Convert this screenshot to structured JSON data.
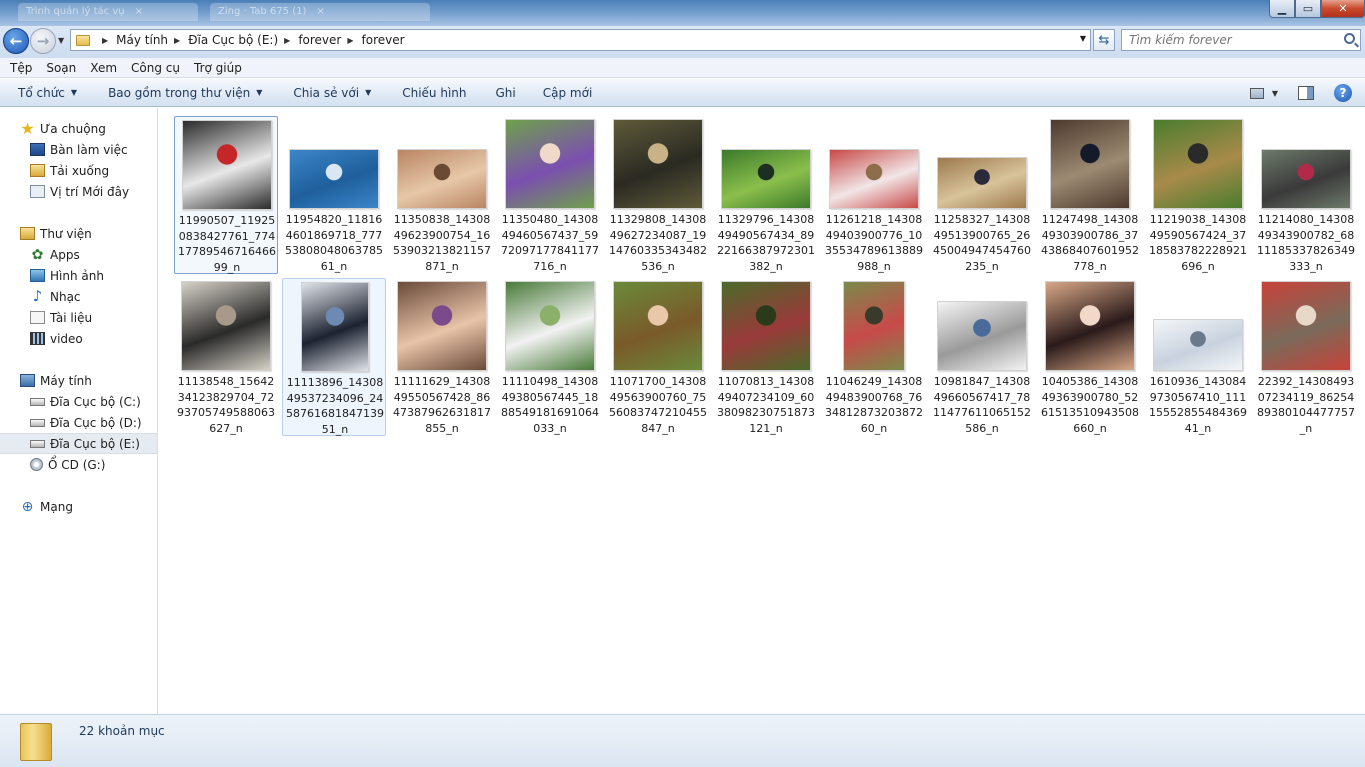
{
  "window": {
    "background_tabs": [
      "Trình quản lý tác vụ",
      "Zing · Tab 675 (1)"
    ]
  },
  "address": {
    "breadcrumbs": [
      "Máy tính",
      "Đĩa Cục bộ (E:)",
      "forever",
      "forever"
    ]
  },
  "search": {
    "placeholder": "Tìm kiếm forever"
  },
  "menu": [
    "Tệp",
    "Soạn",
    "Xem",
    "Công cụ",
    "Trợ giúp"
  ],
  "commands": [
    {
      "label": "Tổ chức",
      "dropdown": true
    },
    {
      "label": "Bao gồm trong thư viện",
      "dropdown": true
    },
    {
      "label": "Chia sẻ với",
      "dropdown": true
    },
    {
      "label": "Chiếu hình",
      "dropdown": false
    },
    {
      "label": "Ghi",
      "dropdown": false
    },
    {
      "label": "Cập mới",
      "dropdown": false
    }
  ],
  "nav": [
    {
      "label": "Ưa chuộng",
      "icon": "star-icon",
      "level": 0
    },
    {
      "label": "Bàn làm việc",
      "icon": "desktop-icon",
      "level": 1
    },
    {
      "label": "Tải xuống",
      "icon": "downloads-icon",
      "level": 1
    },
    {
      "label": "Vị trí Mới đây",
      "icon": "recent-places-icon",
      "level": 1
    },
    {
      "label": "Thư viện",
      "icon": "libraries-icon",
      "level": 0
    },
    {
      "label": "Apps",
      "icon": "apps-icon",
      "level": 1
    },
    {
      "label": "Hình ảnh",
      "icon": "pictures-icon",
      "level": 1
    },
    {
      "label": "Nhạc",
      "icon": "music-icon",
      "level": 1
    },
    {
      "label": "Tài liệu",
      "icon": "documents-icon",
      "level": 1
    },
    {
      "label": "video",
      "icon": "videos-icon",
      "level": 1
    },
    {
      "label": "Máy tính",
      "icon": "computer-icon",
      "level": 0
    },
    {
      "label": "Đĩa Cục bộ (C:)",
      "icon": "drive-icon",
      "level": 1
    },
    {
      "label": "Đĩa Cục bộ (D:)",
      "icon": "drive-icon",
      "level": 1
    },
    {
      "label": "Đĩa Cục bộ (E:)",
      "icon": "drive-icon",
      "level": 1,
      "selected": true
    },
    {
      "label": "Ổ CD (G:)",
      "icon": "cd-drive-icon",
      "level": 1
    },
    {
      "label": "Mạng",
      "icon": "network-icon",
      "level": 0
    }
  ],
  "files": [
    {
      "name": "11990507_119250838427761_7741778954671646699_n",
      "colors": [
        "#2b2b2b",
        "#e8e8e8",
        "#c4262a"
      ]
    },
    {
      "name": "11954820_118164601869718_7775380804806378561_n",
      "colors": [
        "#3b86c9",
        "#1f5f9c",
        "#d9e7f3"
      ]
    },
    {
      "name": "11350838_1430849623900754_1653903213821157871_n",
      "colors": [
        "#b98563",
        "#e6c7a8",
        "#6b4a33"
      ]
    },
    {
      "name": "11350480_1430849460567437_5972097177841177716_n",
      "colors": [
        "#6fa04b",
        "#7b4fb0",
        "#f0d9c8"
      ]
    },
    {
      "name": "11329808_1430849627234087_1914760335343482536_n",
      "colors": [
        "#5f5a3a",
        "#2a2a22",
        "#c9b287"
      ]
    },
    {
      "name": "11329796_1430849490567434_8922166387972301382_n",
      "colors": [
        "#3c7a2b",
        "#8bbf4c",
        "#1d2e22"
      ]
    },
    {
      "name": "11261218_1430849403900776_1035534789613889988_n",
      "colors": [
        "#c84848",
        "#f2e6e6",
        "#8e6e4a"
      ]
    },
    {
      "name": "11258327_1430849513900765_2645004947454760235_n",
      "colors": [
        "#9d7a4d",
        "#d8c39a",
        "#2a2a3a"
      ]
    },
    {
      "name": "11247498_1430849303900786_3743868407601952778_n",
      "colors": [
        "#4d3a2e",
        "#9c8a72",
        "#151a2a"
      ]
    },
    {
      "name": "11219038_1430849590567424_3718583782228921696_n",
      "colors": [
        "#4a7d2e",
        "#a88a4a",
        "#2a2a2a"
      ]
    },
    {
      "name": "11214080_1430849343900782_6811185337826349333_n",
      "colors": [
        "#6d7a6a",
        "#3a3a3a",
        "#b22a4a"
      ]
    },
    {
      "name": "11138548_1564234123829704_7293705749588063627_n",
      "colors": [
        "#d6d2c8",
        "#2a2a2a",
        "#a79a8a"
      ]
    },
    {
      "name": "11113896_1430849537234096_245876168184713951_n",
      "colors": [
        "#e0e4ea",
        "#1c2230",
        "#6d8ab3"
      ]
    },
    {
      "name": "11111629_1430849550567428_8647387962631817855_n",
      "colors": [
        "#6a4a3a",
        "#e8c4a8",
        "#7a4a8a"
      ]
    },
    {
      "name": "11110498_1430849380567445_1888549181691064033_n",
      "colors": [
        "#4a7a3a",
        "#f2f2f2",
        "#8ab06a"
      ]
    },
    {
      "name": "11071700_1430849563900760_7556083747210455847_n",
      "colors": [
        "#6a8a3a",
        "#7a5a2a",
        "#e8c8a8"
      ]
    },
    {
      "name": "11070813_1430849407234109_6038098230751873121_n",
      "colors": [
        "#4a6a2a",
        "#9a3a3a",
        "#2a3a1a"
      ]
    },
    {
      "name": "11046249_1430849483900768_763481287320387260_n",
      "colors": [
        "#7a8a4a",
        "#c84a4a",
        "#3a3a2a"
      ]
    },
    {
      "name": "10981847_1430849660567417_7811477611065152586_n",
      "colors": [
        "#f4f4f4",
        "#9a9a9a",
        "#4a6a9a"
      ]
    },
    {
      "name": "10405386_1430849363900780_5261513510943508660_n",
      "colors": [
        "#d8a888",
        "#2a1a1a",
        "#f2d8c8"
      ]
    },
    {
      "name": "1610936_1430849730567410_1111555285548436941_n",
      "colors": [
        "#f4f6f8",
        "#c8d2de",
        "#6a7a8a"
      ]
    },
    {
      "name": "22392_1430849307234119_8625489380104477757_n",
      "colors": [
        "#c8423a",
        "#7a6a5a",
        "#e8d8c8"
      ]
    }
  ],
  "status": {
    "item_count": "22 khoản mục"
  }
}
